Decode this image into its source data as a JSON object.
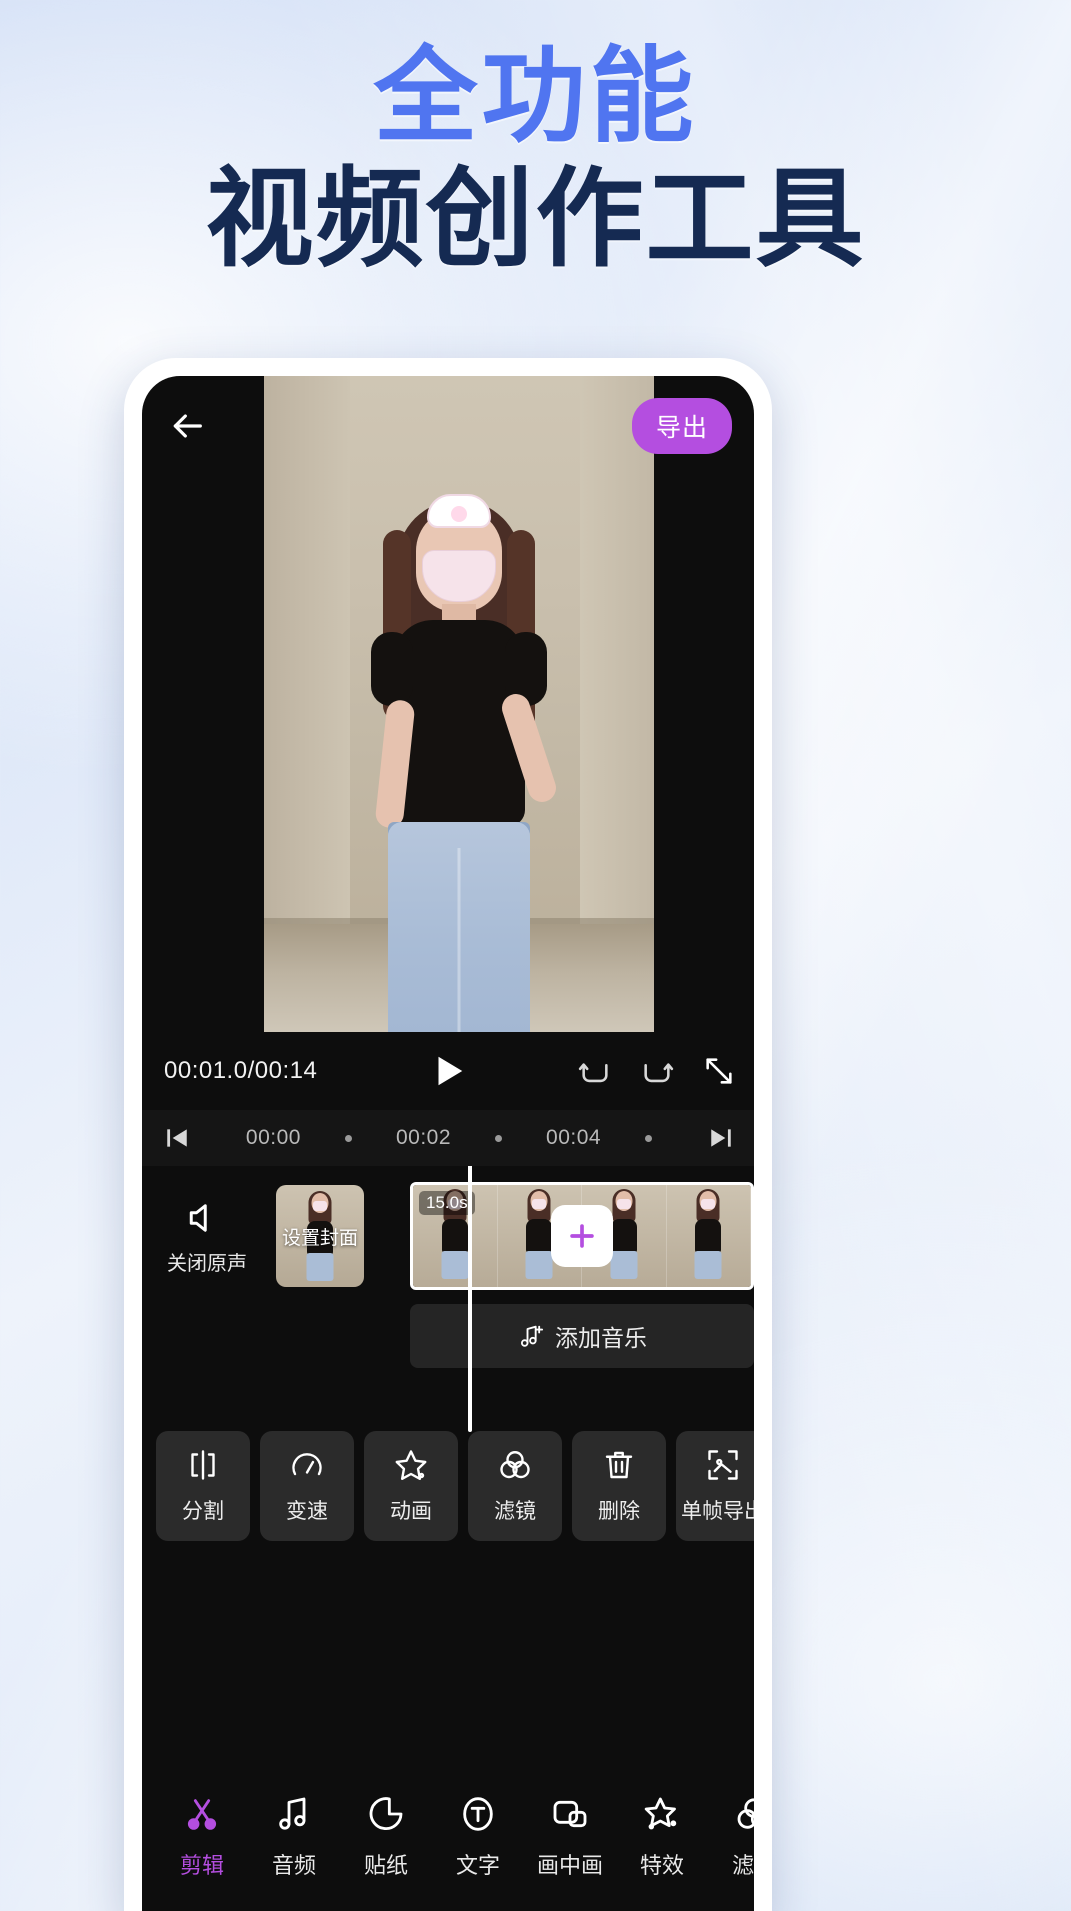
{
  "headline": {
    "line1": "全功能",
    "line2": "视频创作工具",
    "line1_color": "#5075f0",
    "line2_color": "#152a52"
  },
  "app": {
    "topbar": {
      "back_icon": "arrow-left-icon",
      "export_label": "导出",
      "export_color": "#b44ee0"
    },
    "player": {
      "current_time": "00:01.0",
      "total_time": "00:14",
      "time_display": "00:01.0/00:14",
      "play_icon": "play-icon",
      "undo_icon": "undo-icon",
      "redo_icon": "redo-icon",
      "fullscreen_icon": "expand-icon"
    },
    "ruler": {
      "start_icon": "skip-to-start-icon",
      "end_icon": "skip-to-end-icon",
      "ticks": [
        "00:00",
        "•",
        "00:02",
        "•",
        "00:04",
        "•"
      ]
    },
    "timeline": {
      "mute_icon": "speaker-mute-icon",
      "mute_label": "关闭原声",
      "cover_label": "设置封面",
      "clip_duration": "15.0s",
      "add_clip_icon": "plus-icon",
      "add_clip_color": "#b44ee0",
      "music_icon": "music-note-add-icon",
      "music_label": "添加音乐"
    },
    "tools": [
      {
        "label": "分割",
        "icon": "split-icon"
      },
      {
        "label": "变速",
        "icon": "speedometer-icon"
      },
      {
        "label": "动画",
        "icon": "star-sparkle-icon"
      },
      {
        "label": "滤镜",
        "icon": "color-circles-icon"
      },
      {
        "label": "删除",
        "icon": "trash-icon"
      },
      {
        "label": "单帧导出",
        "icon": "frame-export-icon"
      }
    ],
    "bottom_nav": [
      {
        "label": "剪辑",
        "icon": "scissors-icon",
        "active": true
      },
      {
        "label": "音频",
        "icon": "music-note-icon",
        "active": false
      },
      {
        "label": "贴纸",
        "icon": "sticker-icon",
        "active": false
      },
      {
        "label": "文字",
        "icon": "text-circle-icon",
        "active": false
      },
      {
        "label": "画中画",
        "icon": "picture-in-picture-icon",
        "active": false
      },
      {
        "label": "特效",
        "icon": "magic-star-icon",
        "active": false
      },
      {
        "label": "滤镜",
        "icon": "filter-circles-icon",
        "active": false
      }
    ]
  }
}
